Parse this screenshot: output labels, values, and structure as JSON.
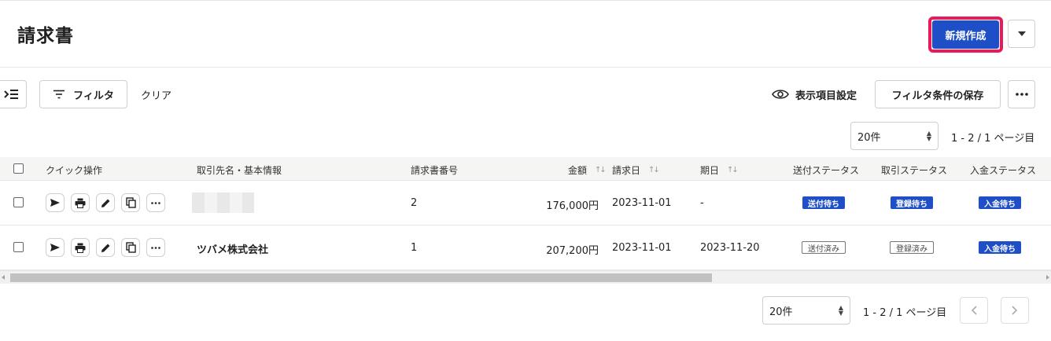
{
  "header": {
    "title": "請求書",
    "create_label": "新規作成",
    "accent_color": "#1e4fc7",
    "highlight_color": "#e8195c"
  },
  "toolbar": {
    "filter_label": "フィルタ",
    "clear_label": "クリア",
    "display_settings_label": "表示項目設定",
    "save_filter_label": "フィルタ条件の保存"
  },
  "pagination": {
    "per_page": "20件",
    "info": "1 - 2 / 1 ページ目"
  },
  "table": {
    "columns": {
      "quick_actions": "クイック操作",
      "partner": "取引先名・基本情報",
      "invoice_no": "請求書番号",
      "amount": "金額",
      "invoice_date": "請求日",
      "due_date": "期日",
      "send_status": "送付ステータス",
      "deal_status": "取引ステータス",
      "payment_status": "入金ステータス"
    },
    "rows": [
      {
        "partner": "",
        "invoice_no": "2",
        "amount": "176,000円",
        "invoice_date": "2023-11-01",
        "due_date": "-",
        "send_status": "送付待ち",
        "deal_status": "登録待ち",
        "payment_status": "入金待ち"
      },
      {
        "partner": "ツバメ株式会社",
        "invoice_no": "1",
        "amount": "207,200円",
        "invoice_date": "2023-11-01",
        "due_date": "2023-11-20",
        "send_status": "送付済み",
        "deal_status": "登録済み",
        "payment_status": "入金待ち"
      }
    ]
  },
  "icons": {
    "menu_toggle": "menu-indent-icon",
    "filter": "filter-lines-icon",
    "eye": "eye-icon",
    "more": "more-horizontal-icon",
    "send": "send-icon",
    "print": "printer-icon",
    "edit": "pencil-icon",
    "copy": "copy-icon"
  }
}
